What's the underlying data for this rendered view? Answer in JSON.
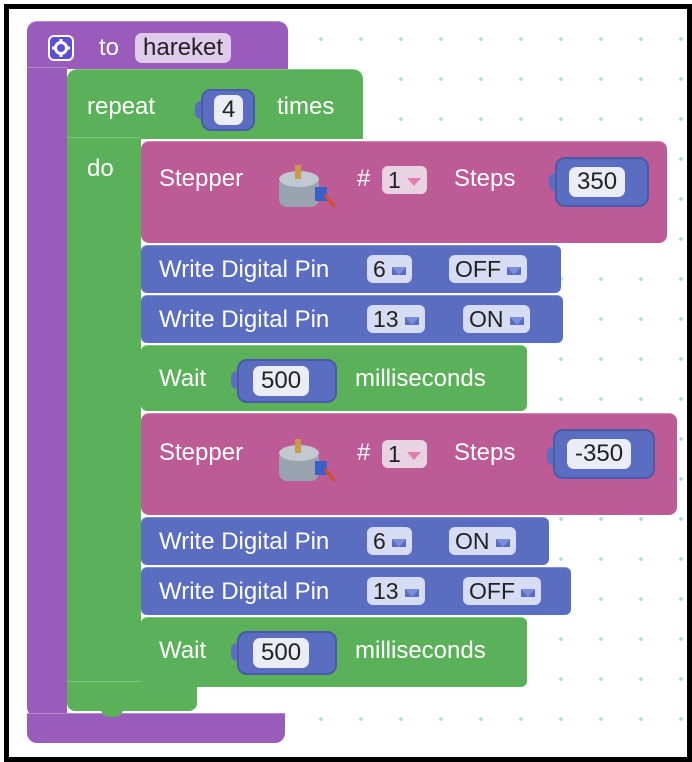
{
  "procedure": {
    "keyword": "to",
    "name": "hareket",
    "icon": "gear-icon"
  },
  "repeat": {
    "label": "repeat",
    "count": "4",
    "suffix": "times",
    "do_label": "do"
  },
  "stepper_blocks": [
    {
      "label": "Stepper",
      "hash": "#",
      "motor": "1",
      "steps_label": "Steps",
      "steps": "350",
      "image": "stepper-motor-image"
    },
    {
      "label": "Stepper",
      "hash": "#",
      "motor": "1",
      "steps_label": "Steps",
      "steps": "-350",
      "image": "stepper-motor-image"
    }
  ],
  "digital_writes": [
    {
      "label": "Write Digital Pin",
      "pin": "6",
      "state": "OFF"
    },
    {
      "label": "Write Digital Pin",
      "pin": "13",
      "state": "ON"
    },
    {
      "label": "Write Digital Pin",
      "pin": "6",
      "state": "ON"
    },
    {
      "label": "Write Digital Pin",
      "pin": "13",
      "state": "OFF"
    }
  ],
  "waits": [
    {
      "label": "Wait",
      "value": "500",
      "unit": "milliseconds"
    },
    {
      "label": "Wait",
      "value": "500",
      "unit": "milliseconds"
    }
  ],
  "colors": {
    "procedure": "#9a5cbb",
    "loop": "#5bb15a",
    "stepper": "#bc5b96",
    "io": "#5a6dc0",
    "grid_dot": "#a7dde6"
  }
}
